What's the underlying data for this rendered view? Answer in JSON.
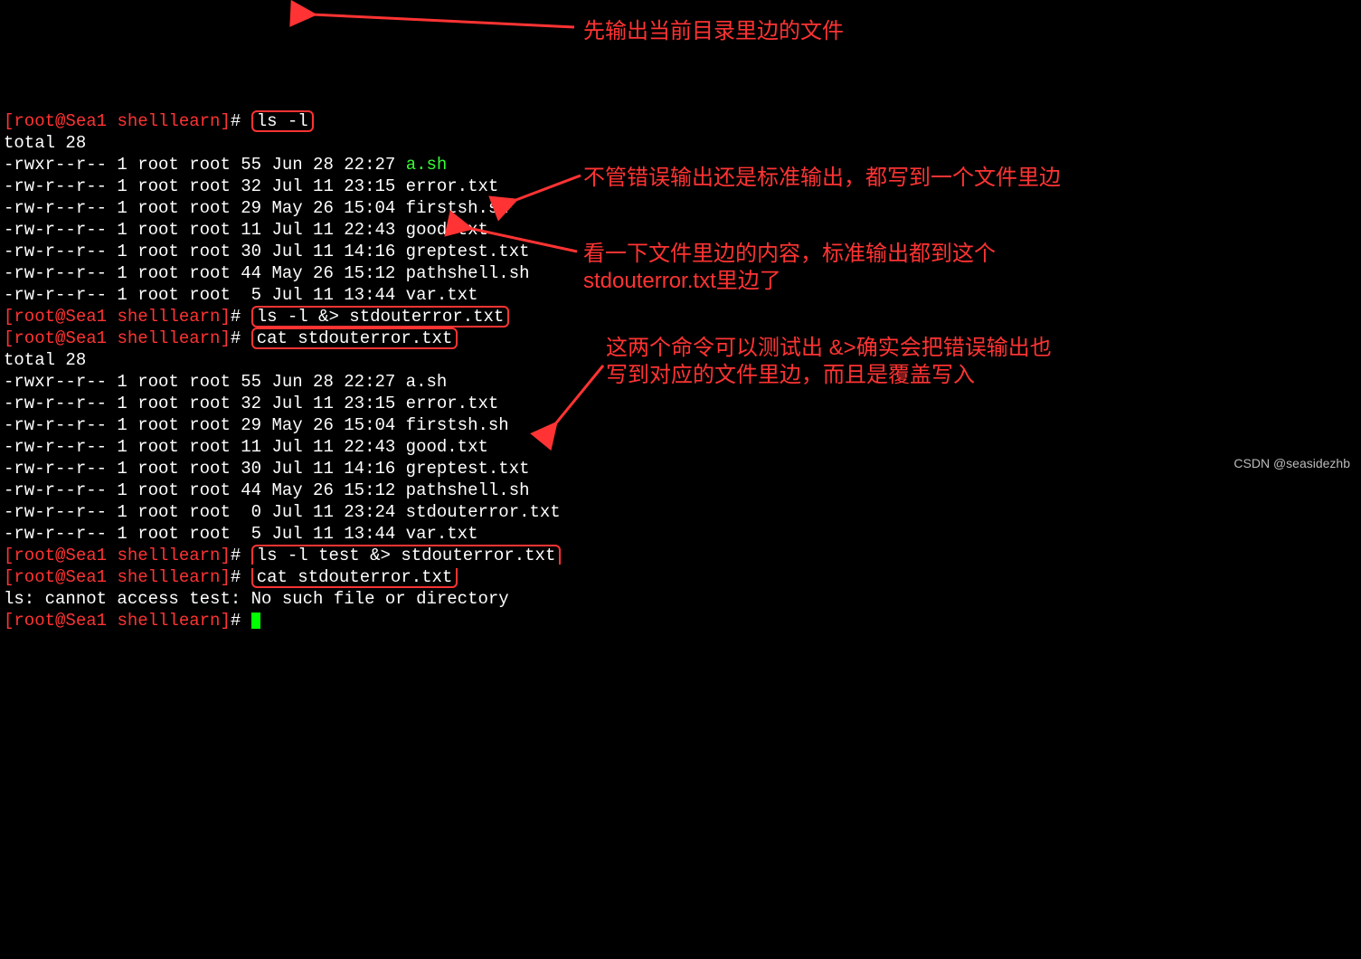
{
  "prompt_user": "root",
  "prompt_host": "Sea1",
  "prompt_dir": "shelllearn",
  "cmd1": "ls -l",
  "cmd2": "ls -l &> stdouterror.txt",
  "cmd3": "cat stdouterror.txt",
  "cmd4": "ls -l test &> stdouterror.txt",
  "cmd5": "cat stdouterror.txt",
  "total1": "total 28",
  "total2": "total 28",
  "ls1": [
    {
      "l": "-rwxr--r-- 1 root root 55 Jun 28 22:27 ",
      "f": "a.sh",
      "g": true
    },
    {
      "l": "-rw-r--r-- 1 root root 32 Jul 11 23:15 error.txt"
    },
    {
      "l": "-rw-r--r-- 1 root root 29 May 26 15:04 firstsh.sh"
    },
    {
      "l": "-rw-r--r-- 1 root root 11 Jul 11 22:43 good.txt"
    },
    {
      "l": "-rw-r--r-- 1 root root 30 Jul 11 14:16 greptest.txt"
    },
    {
      "l": "-rw-r--r-- 1 root root 44 May 26 15:12 pathshell.sh"
    },
    {
      "l": "-rw-r--r-- 1 root root  5 Jul 11 13:44 var.txt"
    }
  ],
  "ls2": [
    {
      "l": "-rwxr--r-- 1 root root 55 Jun 28 22:27 a.sh"
    },
    {
      "l": "-rw-r--r-- 1 root root 32 Jul 11 23:15 error.txt"
    },
    {
      "l": "-rw-r--r-- 1 root root 29 May 26 15:04 firstsh.sh"
    },
    {
      "l": "-rw-r--r-- 1 root root 11 Jul 11 22:43 good.txt"
    },
    {
      "l": "-rw-r--r-- 1 root root 30 Jul 11 14:16 greptest.txt"
    },
    {
      "l": "-rw-r--r-- 1 root root 44 May 26 15:12 pathshell.sh"
    },
    {
      "l": "-rw-r--r-- 1 root root  0 Jul 11 23:24 stdouterror.txt"
    },
    {
      "l": "-rw-r--r-- 1 root root  5 Jul 11 13:44 var.txt"
    }
  ],
  "err": "ls: cannot access test: No such file or directory",
  "note1": "先输出当前目录里边的文件",
  "note2": "不管错误输出还是标准输出，都写到一个文件里边",
  "note3a": "看一下文件里边的内容，标准输出都到这个",
  "note3b": "stdouterror.txt里边了",
  "note4a": "这两个命令可以测试出 &>确实会把错误输出也",
  "note4b": "写到对应的文件里边，而且是覆盖写入",
  "watermark": "CSDN @seasidezhb"
}
